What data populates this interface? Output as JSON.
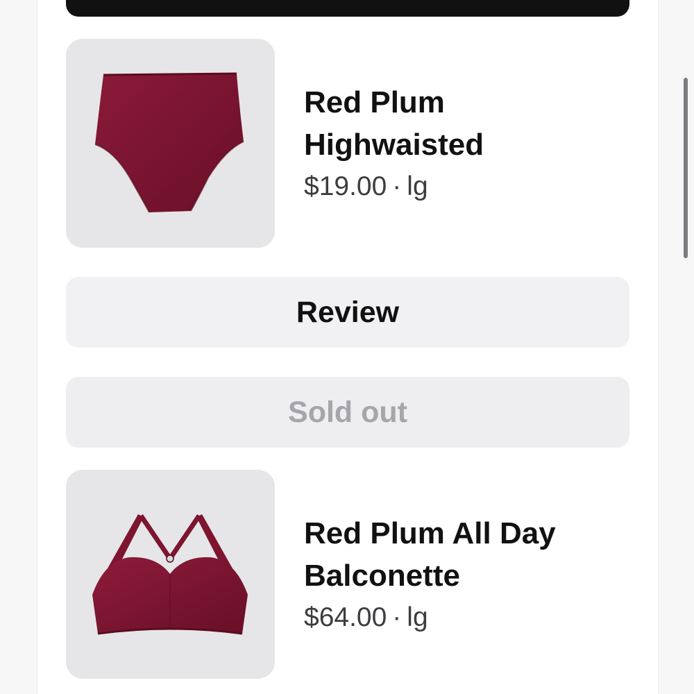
{
  "items": [
    {
      "name_line1": "Red Plum",
      "name_line2": "Highwaisted",
      "price": "$19.00",
      "separator": "·",
      "size": "lg",
      "image": "red-plum-highwaisted-brief"
    },
    {
      "name_line1": "Red Plum All Day",
      "name_line2": "Balconette",
      "price": "$64.00",
      "separator": "·",
      "size": "lg",
      "image": "red-plum-balconette-bra"
    }
  ],
  "actions": {
    "review_label": "Review",
    "sold_out_label": "Sold out"
  },
  "colors": {
    "product": "#7d1530",
    "thumb_bg": "#e6e6e8",
    "button_bg": "#f1f1f3",
    "disabled_text": "#a6a6aa"
  }
}
